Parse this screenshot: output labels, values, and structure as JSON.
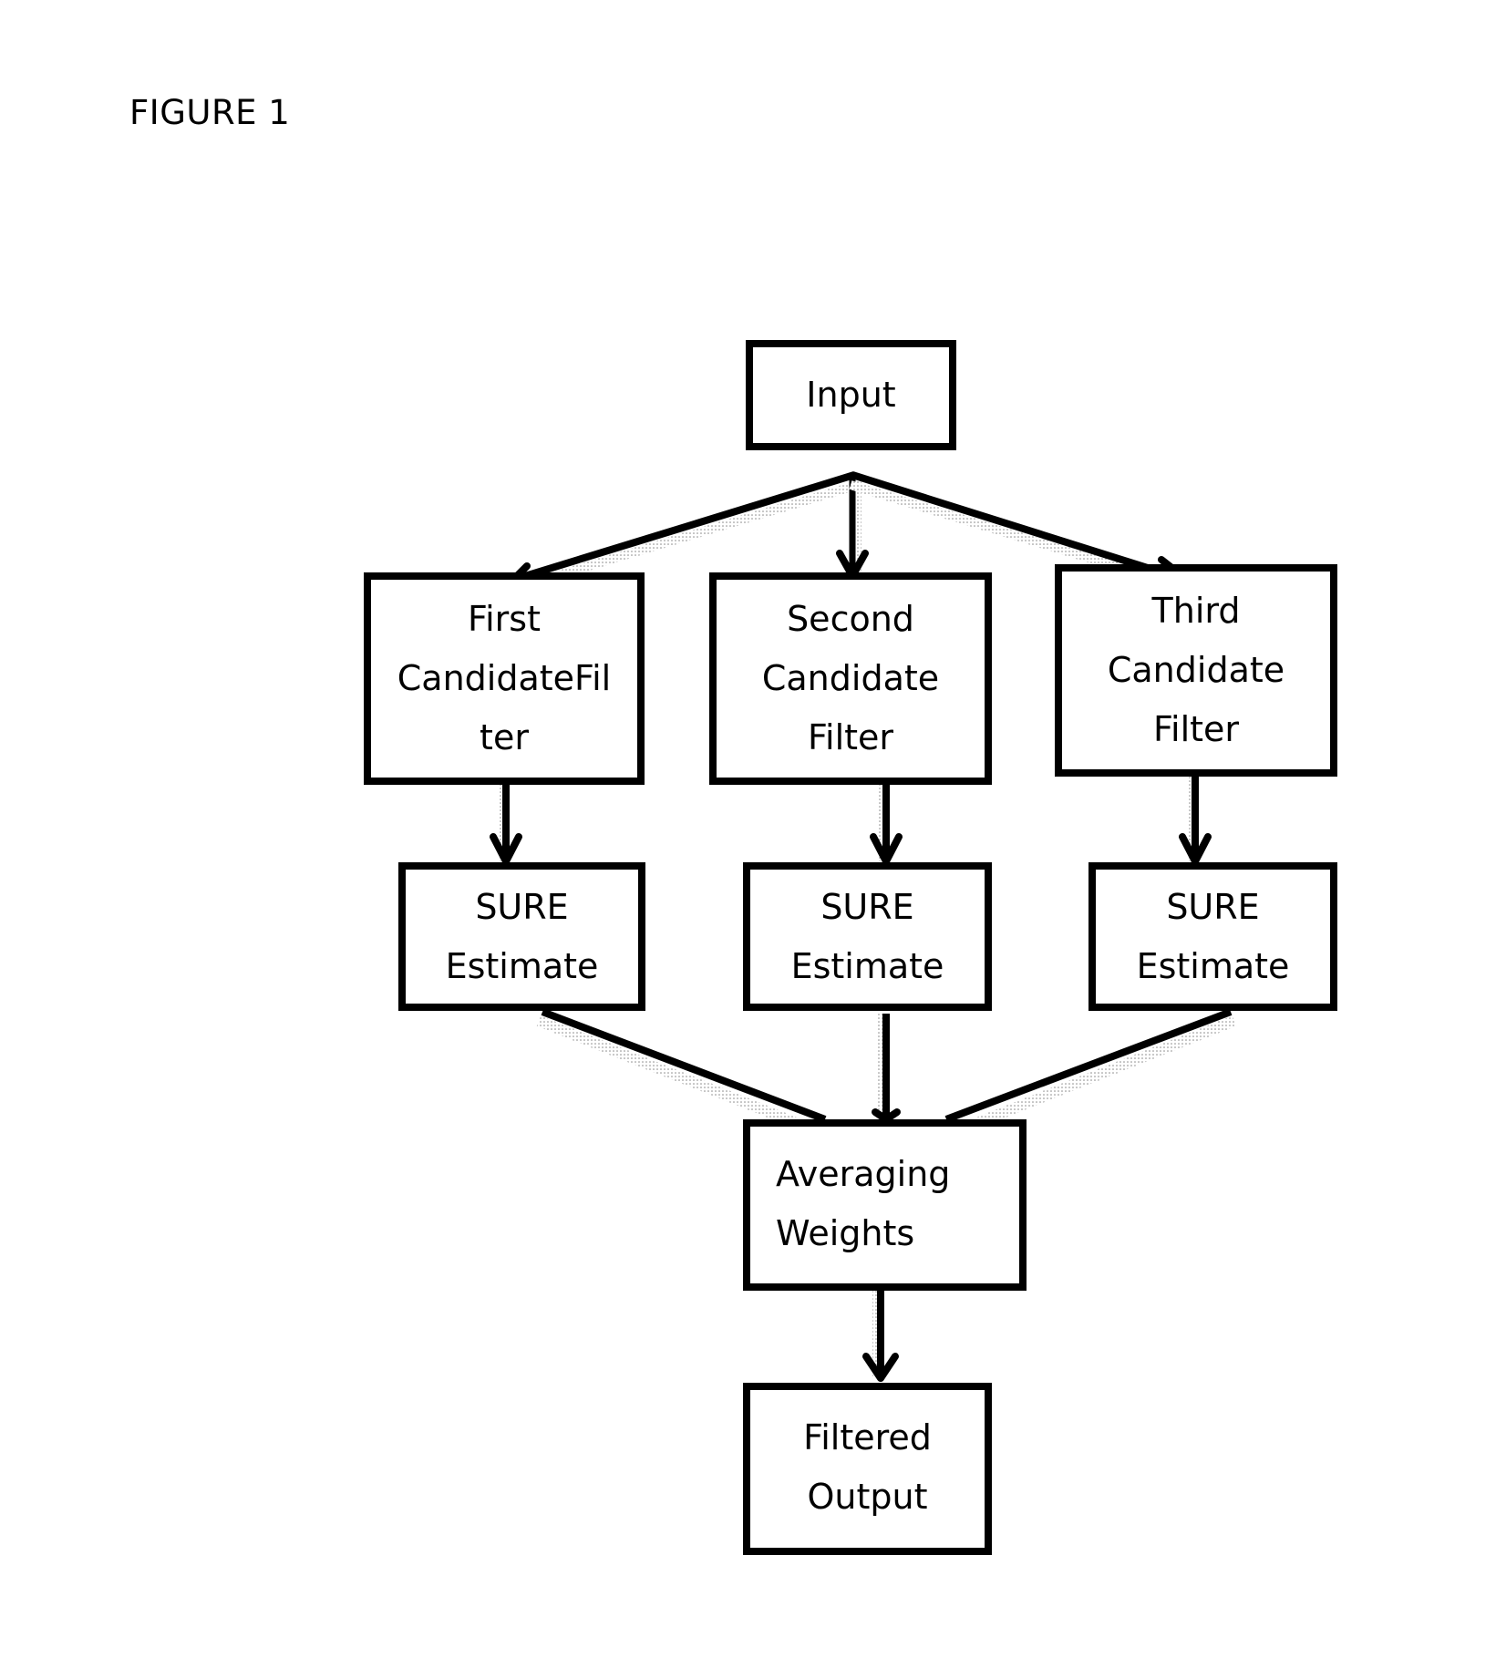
{
  "figure": {
    "title": "FIGURE 1"
  },
  "nodes": {
    "input": {
      "lines": [
        "Input"
      ]
    },
    "filter1": {
      "lines": [
        "First",
        "CandidateFil",
        "ter"
      ]
    },
    "filter2": {
      "lines": [
        "Second",
        "Candidate",
        "Filter"
      ]
    },
    "filter3": {
      "lines": [
        "Third",
        "Candidate",
        "Filter"
      ]
    },
    "sure1": {
      "lines": [
        "SURE",
        "Estimate"
      ]
    },
    "sure2": {
      "lines": [
        "SURE",
        "Estimate"
      ]
    },
    "sure3": {
      "lines": [
        "SURE",
        "Estimate"
      ]
    },
    "averaging": {
      "lines": [
        "Averaging",
        "Weights"
      ]
    },
    "output": {
      "lines": [
        "Filtered",
        "Output"
      ]
    }
  },
  "edges": [
    {
      "from": "input",
      "to": "filter1",
      "arrow": true
    },
    {
      "from": "input",
      "to": "filter2",
      "arrow": true
    },
    {
      "from": "input",
      "to": "filter3",
      "arrow": true
    },
    {
      "from": "filter1",
      "to": "sure1",
      "arrow": true
    },
    {
      "from": "filter2",
      "to": "sure2",
      "arrow": true
    },
    {
      "from": "filter3",
      "to": "sure3",
      "arrow": true
    },
    {
      "from": "sure1",
      "to": "averaging",
      "arrow": false
    },
    {
      "from": "sure2",
      "to": "averaging",
      "arrow": true
    },
    {
      "from": "sure3",
      "to": "averaging",
      "arrow": false
    },
    {
      "from": "averaging",
      "to": "output",
      "arrow": true
    }
  ]
}
